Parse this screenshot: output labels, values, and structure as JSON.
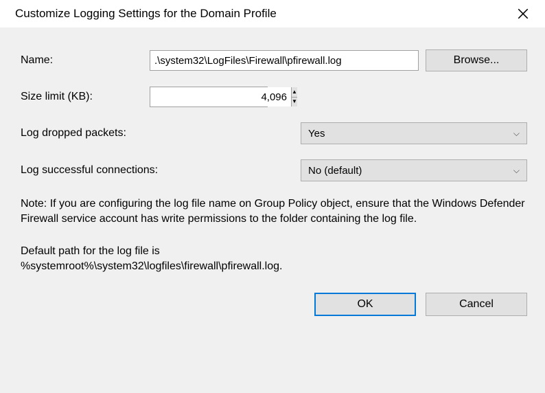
{
  "window": {
    "title": "Customize Logging Settings for the Domain Profile"
  },
  "form": {
    "name_label": "Name:",
    "name_value": ".\\system32\\LogFiles\\Firewall\\pfirewall.log",
    "browse_label": "Browse...",
    "size_label": "Size limit (KB):",
    "size_value": "4,096",
    "dropped_label": "Log dropped packets:",
    "dropped_value": "Yes",
    "connections_label": "Log successful connections:",
    "connections_value": "No (default)"
  },
  "notes": {
    "main": "Note: If you are configuring the log file name on Group Policy object, ensure that the Windows Defender Firewall service account has write permissions to the folder containing the log file.",
    "path_intro": "Default path for the log file is",
    "path_value": "%systemroot%\\system32\\logfiles\\firewall\\pfirewall.log."
  },
  "buttons": {
    "ok": "OK",
    "cancel": "Cancel"
  }
}
